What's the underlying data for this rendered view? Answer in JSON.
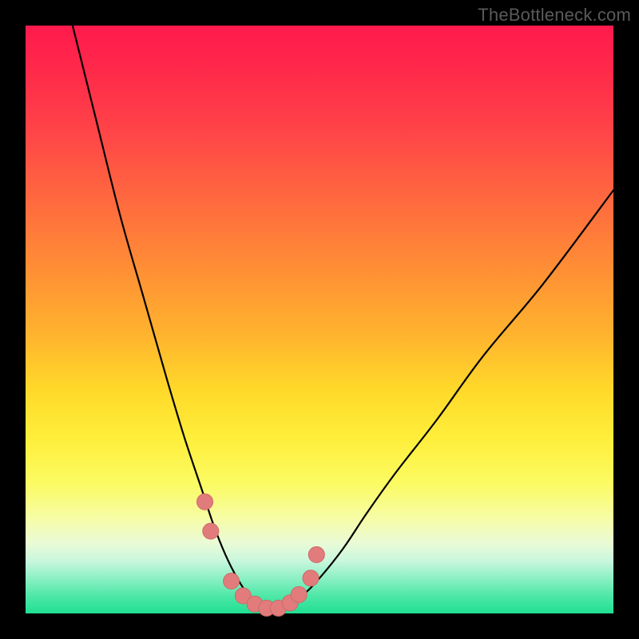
{
  "watermark": "TheBottleneck.com",
  "colors": {
    "frame": "#000000",
    "watermark": "#5a5a5a",
    "curve": "#000000",
    "marker_fill": "#e27c7c",
    "marker_stroke": "#d06868",
    "gradient": [
      "#ff1a4d",
      "#ff2a4a",
      "#ff4448",
      "#ff6a3e",
      "#ff8a36",
      "#ffb12e",
      "#ffd92a",
      "#ffee3a",
      "#fbfb63",
      "#f6fca8",
      "#eafbd6",
      "#c9f7dd",
      "#8cf0c4",
      "#4fe7a8",
      "#1fe093"
    ]
  },
  "chart_data": {
    "type": "line",
    "title": "",
    "xlabel": "",
    "ylabel": "",
    "xlim": [
      0,
      100
    ],
    "ylim": [
      0,
      100
    ],
    "grid": false,
    "legend": false,
    "series": [
      {
        "name": "bottleneck-curve",
        "x": [
          8,
          12,
          16,
          20,
          24,
          27,
          30,
          32,
          34,
          36,
          38,
          40,
          42,
          44,
          47,
          50,
          54,
          58,
          63,
          70,
          78,
          88,
          100
        ],
        "y": [
          100,
          84,
          68,
          54,
          40,
          30,
          21,
          15,
          10,
          6,
          3,
          1.2,
          0.6,
          1.2,
          3,
          6,
          11,
          17,
          24,
          33,
          44,
          56,
          72
        ]
      }
    ],
    "markers": [
      {
        "x": 30.5,
        "y": 19
      },
      {
        "x": 31.5,
        "y": 14
      },
      {
        "x": 35.0,
        "y": 5.5
      },
      {
        "x": 37.0,
        "y": 3.0
      },
      {
        "x": 39.0,
        "y": 1.6
      },
      {
        "x": 41.0,
        "y": 0.9
      },
      {
        "x": 43.0,
        "y": 0.9
      },
      {
        "x": 45.0,
        "y": 1.8
      },
      {
        "x": 46.5,
        "y": 3.2
      },
      {
        "x": 48.5,
        "y": 6.0
      },
      {
        "x": 49.5,
        "y": 10.0
      }
    ]
  }
}
